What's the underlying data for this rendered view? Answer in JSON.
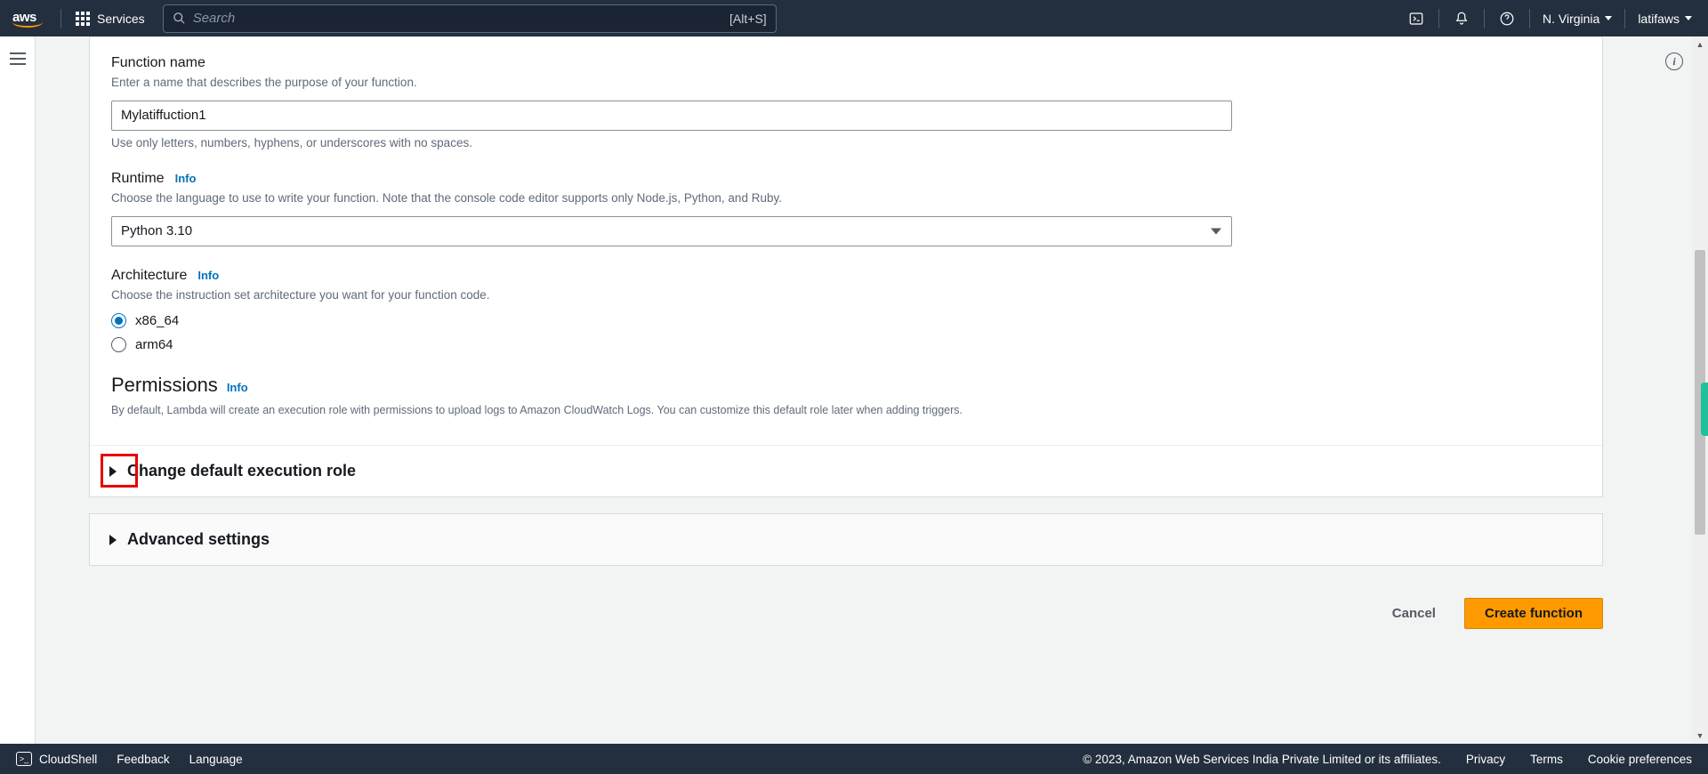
{
  "topnav": {
    "brand": "aws",
    "services_label": "Services",
    "search_placeholder": "Search",
    "search_shortcut": "[Alt+S]",
    "region": "N. Virginia",
    "account": "latifaws"
  },
  "form": {
    "function_name": {
      "label": "Function name",
      "help": "Enter a name that describes the purpose of your function.",
      "value": "Mylatiffuction1",
      "constraint": "Use only letters, numbers, hyphens, or underscores with no spaces."
    },
    "runtime": {
      "label": "Runtime",
      "info": "Info",
      "help": "Choose the language to use to write your function. Note that the console code editor supports only Node.js, Python, and Ruby.",
      "value": "Python 3.10"
    },
    "architecture": {
      "label": "Architecture",
      "info": "Info",
      "help": "Choose the instruction set architecture you want for your function code.",
      "options": [
        "x86_64",
        "arm64"
      ],
      "selected": "x86_64"
    },
    "permissions": {
      "title": "Permissions",
      "info": "Info",
      "desc": "By default, Lambda will create an execution role with permissions to upload logs to Amazon CloudWatch Logs. You can customize this default role later when adding triggers."
    },
    "exec_role_expand": "Change default execution role",
    "advanced_expand": "Advanced settings",
    "cancel": "Cancel",
    "create": "Create function"
  },
  "bottomnav": {
    "cloudshell": "CloudShell",
    "feedback": "Feedback",
    "language": "Language",
    "copyright": "© 2023, Amazon Web Services India Private Limited or its affiliates.",
    "privacy": "Privacy",
    "terms": "Terms",
    "cookies": "Cookie preferences"
  }
}
